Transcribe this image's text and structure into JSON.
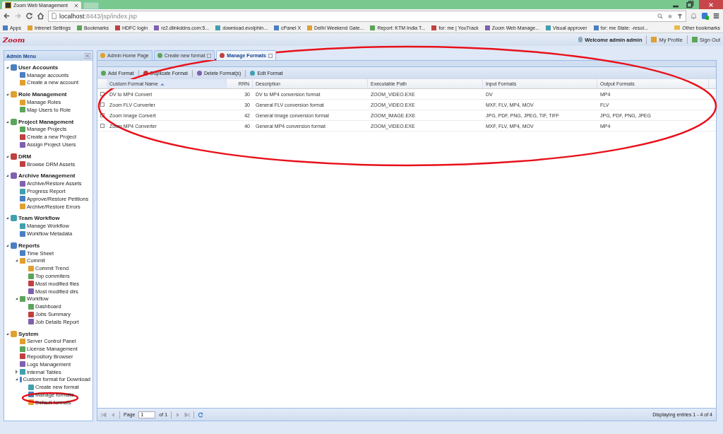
{
  "browser": {
    "tab_title": "Zoom Web Management",
    "address_host": "localhost",
    "address_path": ":8443/jsp/index.jsp",
    "bookmarks": [
      {
        "label": "Apps"
      },
      {
        "label": "Intrenet Settings"
      },
      {
        "label": "Bookmarks"
      },
      {
        "label": "HDFC login"
      },
      {
        "label": "rz2.dlinkddns.com:5..."
      },
      {
        "label": "download.evolphin..."
      },
      {
        "label": "cPanel X"
      },
      {
        "label": "Delhi Weekend Gate..."
      },
      {
        "label": "Report: KTM India T..."
      },
      {
        "label": "for: me | YouTrack"
      },
      {
        "label": "Zoom Web Manage..."
      },
      {
        "label": "Visual approver"
      },
      {
        "label": "for: me State: -resol..."
      }
    ],
    "other_bookmarks": "Other bookmarks"
  },
  "header": {
    "logo": "Zoom",
    "welcome": "Welcome admin admin",
    "links": [
      "My Profile",
      "Sign Out"
    ]
  },
  "sidebar": {
    "title": "Admin Menu",
    "groups": [
      {
        "label": "User Accounts",
        "expanded": true,
        "children": [
          {
            "label": "Manage accounts"
          },
          {
            "label": "Create a new account"
          }
        ]
      },
      {
        "label": "Role Management",
        "expanded": true,
        "children": [
          {
            "label": "Manage Roles"
          },
          {
            "label": "Map Users to Role"
          }
        ]
      },
      {
        "label": "Project Management",
        "expanded": true,
        "children": [
          {
            "label": "Manage Projects"
          },
          {
            "label": "Create a new Project"
          },
          {
            "label": "Assign Project Users"
          }
        ]
      },
      {
        "label": "DRM",
        "expanded": true,
        "children": [
          {
            "label": "Browse DRM Assets"
          }
        ]
      },
      {
        "label": "Archive Management",
        "expanded": true,
        "children": [
          {
            "label": "Archive/Restore Assets"
          },
          {
            "label": "Progress Report"
          },
          {
            "label": "Approve/Restore Petitions"
          },
          {
            "label": "Archive/Restore Errors"
          }
        ]
      },
      {
        "label": "Team Workflow",
        "expanded": true,
        "children": [
          {
            "label": "Manage Workflow"
          },
          {
            "label": "Workflow Metadata"
          }
        ]
      },
      {
        "label": "Reports",
        "expanded": true,
        "children": [
          {
            "label": "Time Sheet"
          },
          {
            "label": "Commit",
            "expanded": true,
            "children": [
              {
                "label": "Commit Trend"
              },
              {
                "label": "Top commiters"
              },
              {
                "label": "Most modified files"
              },
              {
                "label": "Most modified dirs"
              }
            ]
          },
          {
            "label": "Workflow",
            "expanded": true,
            "children": [
              {
                "label": "Dashboard"
              },
              {
                "label": "Jobs Summary"
              },
              {
                "label": "Job Details Report"
              }
            ]
          }
        ]
      },
      {
        "label": "System",
        "expanded": true,
        "children": [
          {
            "label": "Server Control Panel"
          },
          {
            "label": "License Management"
          },
          {
            "label": "Repository Browser"
          },
          {
            "label": "Logs Management"
          },
          {
            "label": "Internal Tables",
            "expanded": false
          },
          {
            "label": "Custom format for Download",
            "expanded": true,
            "children": [
              {
                "label": "Create new format"
              },
              {
                "label": "Manage formats"
              },
              {
                "label": "Default formats"
              }
            ]
          }
        ]
      }
    ]
  },
  "tabs": [
    {
      "label": "Admin Home Page",
      "selected": false,
      "closable": false
    },
    {
      "label": "Create new format",
      "selected": false,
      "closable": true
    },
    {
      "label": "Manage Formats",
      "selected": true,
      "closable": true
    }
  ],
  "toolbar": [
    "Add Format",
    "Duplicate Format",
    "Delete Format(s)",
    "Edit Format"
  ],
  "table": {
    "columns": [
      {
        "label": "Custom Format Name",
        "sorted": true
      },
      {
        "label": "RRN",
        "sorted": false
      },
      {
        "label": "Description",
        "sorted": false
      },
      {
        "label": "Executable Path",
        "sorted": false
      },
      {
        "label": "Input Formats",
        "sorted": false
      },
      {
        "label": "Output Formats",
        "sorted": false
      }
    ],
    "rows": [
      [
        "DV to MP4 Convert",
        "30",
        "DV to MP4 conversion format",
        "ZOOM_VIDEO.EXE",
        "DV",
        "MP4"
      ],
      [
        "Zoom FLV Converter",
        "30",
        "General FLV conversion format",
        "ZOOM_VIDEO.EXE",
        "MXF, FLV, MP4, MOV",
        "FLV"
      ],
      [
        "Zoom Image Convert",
        "42",
        "General Image conversion format",
        "ZOOM_IMAGE.EXE",
        "JPG, PDF, PNG, JPEG, TIF, TIFF",
        "JPG, PDF, PNG, JPEG"
      ],
      [
        "Zoom MP4 Converter",
        "40",
        "General MP4 conversion format",
        "ZOOM_VIDEO.EXE",
        "MXF, FLV, MP4, MOV",
        "MP4"
      ]
    ]
  },
  "paging": {
    "page_label": "Page",
    "page": "1",
    "of": "of 1",
    "display": "Displaying entries 1 - 4 of 4"
  }
}
